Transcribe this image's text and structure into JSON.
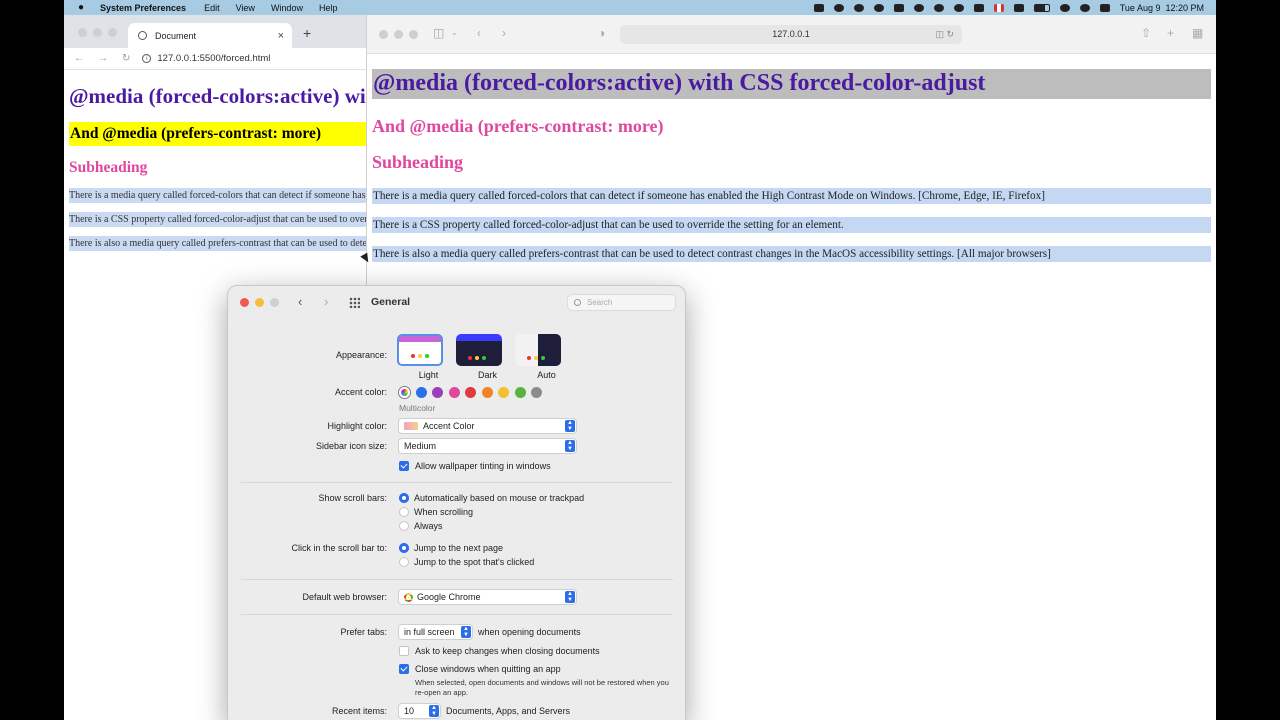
{
  "menubar": {
    "app_name": "System Preferences",
    "menus": [
      "Edit",
      "View",
      "Window",
      "Help"
    ],
    "datetime": "Tue Aug 9  12:20 PM"
  },
  "chrome": {
    "tab_title": "Document",
    "url": "127.0.0.1:5500/forced.html",
    "page": {
      "h1": "@media (forced-colors:active) with CSS forced-color-adjust",
      "h2": "And @media (prefers-contrast: more)",
      "h3": "Subheading",
      "paragraphs": [
        "There is a media query called forced-colors that can detect if someone has enabled the High Contrast Mode on Windows. [Chrome, Edge, IE, Firefox]",
        "There is a CSS property called forced-color-adjust that can be used to override the setting for an element.",
        "There is also a media query called prefers-contrast that can be used to detect contrast changes in the MacOS accessibility settings. [All major browsers]"
      ]
    }
  },
  "safari": {
    "address": "127.0.0.1",
    "page": {
      "h1": "@media (forced-colors:active) with CSS forced-color-adjust",
      "h2": "And @media (prefers-contrast: more)",
      "h3": "Subheading",
      "paragraphs": [
        "There is a media query called forced-colors that can detect if someone has enabled the High Contrast Mode on Windows. [Chrome, Edge, IE, Firefox]",
        "There is a CSS property called forced-color-adjust that can be used to override the setting for an element.",
        "There is also a media query called prefers-contrast that can be used to detect contrast changes in the MacOS accessibility settings. [All major browsers]"
      ]
    }
  },
  "prefs": {
    "title": "General",
    "search_placeholder": "Search",
    "appearance": {
      "label": "Appearance:",
      "options": [
        "Light",
        "Dark",
        "Auto"
      ],
      "selected": "Light"
    },
    "accent": {
      "label": "Accent color:",
      "selected_name": "Multicolor",
      "colors": [
        "#2b6ee8",
        "#9a3fb8",
        "#e0479e",
        "#e0393e",
        "#f0832a",
        "#f5c02e",
        "#5ab33d",
        "#8c8c8c"
      ]
    },
    "highlight": {
      "label": "Highlight color:",
      "value": "Accent Color"
    },
    "sidebar_icon": {
      "label": "Sidebar icon size:",
      "value": "Medium"
    },
    "wallpaper_tinting": {
      "label": "Allow wallpaper tinting in windows",
      "checked": true
    },
    "scroll_bars": {
      "label": "Show scroll bars:",
      "options": [
        "Automatically based on mouse or trackpad",
        "When scrolling",
        "Always"
      ],
      "selected": 0
    },
    "scroll_click": {
      "label": "Click in the scroll bar to:",
      "options": [
        "Jump to the next page",
        "Jump to the spot that's clicked"
      ],
      "selected": 0
    },
    "browser": {
      "label": "Default web browser:",
      "value": "Google Chrome"
    },
    "tabs": {
      "label": "Prefer tabs:",
      "value": "in full screen",
      "suffix": "when opening documents"
    },
    "ask_keep_changes": {
      "label": "Ask to keep changes when closing documents",
      "checked": false
    },
    "close_windows": {
      "label": "Close windows when quitting an app",
      "checked": true
    },
    "close_windows_note": "When selected, open documents and windows will not be restored when you re-open an app.",
    "recent": {
      "label": "Recent items:",
      "value": "10",
      "suffix": "Documents, Apps, and Servers"
    }
  }
}
